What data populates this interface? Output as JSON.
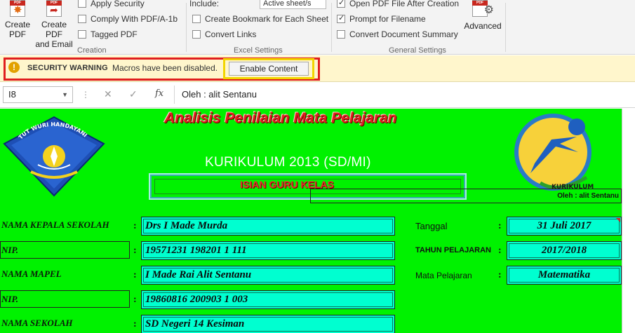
{
  "ribbon": {
    "creation": {
      "create_pdf": [
        "Create",
        "PDF"
      ],
      "create_pdf_email": [
        "Create PDF",
        "and Email"
      ],
      "options": [
        {
          "label": "Apply Security",
          "checked": false
        },
        {
          "label": "Comply With PDF/A-1b",
          "checked": false
        },
        {
          "label": "Tagged PDF",
          "checked": false
        }
      ],
      "group_label": "Creation"
    },
    "excel_settings": {
      "include_label": "Include:",
      "include_value": "Active sheet/s",
      "options": [
        {
          "label": "Create Bookmark for Each Sheet",
          "checked": false
        },
        {
          "label": "Convert Links",
          "checked": false
        }
      ],
      "group_label": "Excel Settings"
    },
    "general_settings": {
      "options": [
        {
          "label": "Open PDF File After Creation",
          "checked": true
        },
        {
          "label": "Prompt for Filename",
          "checked": true
        },
        {
          "label": "Convert Document Summary",
          "checked": false
        }
      ],
      "advanced_label": "Advanced",
      "group_label": "General Settings"
    },
    "pdf_tag": "PDF"
  },
  "security_bar": {
    "title": "SECURITY WARNING",
    "message": "Macros have been disabled.",
    "button": "Enable Content",
    "accent_red": "#e01e1e",
    "accent_yellow": "#f2d500"
  },
  "formula_bar": {
    "name_box": "I8",
    "formula": "Oleh : alit Sentanu"
  },
  "sheet": {
    "background": "#00f200",
    "title": "Analisis Penilaian Mata Pelajaran",
    "subtitle": "KURIKULUM 2013 (SD/MI)",
    "banner": "ISIAN GURU KELAS",
    "byline": "Oleh : alit Sentanu",
    "logo_left_text": "TUT WURI HANDAYANI",
    "logo_right_text": "KURIKULUM",
    "left_fields": [
      {
        "label": "NAMA KEPALA SEKOLAH",
        "value": "Drs I Made Murda"
      },
      {
        "label": "NIP.",
        "value": "19571231 198201 1 111"
      },
      {
        "label": "NAMA MAPEL",
        "value": "I Made Rai Alit Sentanu"
      },
      {
        "label": "NIP.",
        "value": "19860816 200903 1 003"
      },
      {
        "label": "NAMA SEKOLAH",
        "value": "SD Negeri 14 Kesiman"
      }
    ],
    "right_fields": [
      {
        "label": "Tanggal",
        "value": "31 Juli 2017"
      },
      {
        "label": "TAHUN PELAJARAN",
        "value": "2017/2018"
      },
      {
        "label": "Mata Pelajaran",
        "value": "Matematika"
      }
    ],
    "colon": ":"
  }
}
